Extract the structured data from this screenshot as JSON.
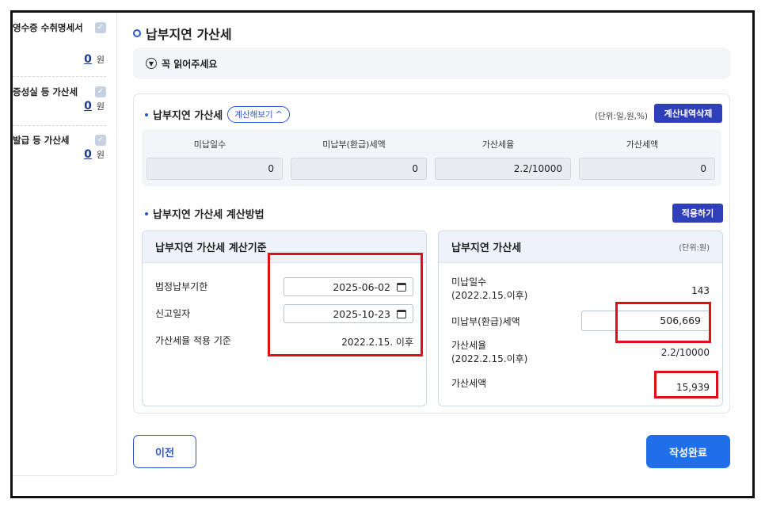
{
  "sidebar": {
    "items": [
      {
        "title": "영수증 수취명세서",
        "amount": "0",
        "unit": "원"
      },
      {
        "title": "증성실 등 가산세",
        "amount": "0",
        "unit": "원"
      },
      {
        "title": "발급 등 가산세",
        "amount": "0",
        "unit": "원"
      }
    ],
    "check_glyph": "✓"
  },
  "page": {
    "title": "납부지연 가산세",
    "read_notice": "꼭 읽어주세요"
  },
  "summary": {
    "title": "납부지연 가산세",
    "calc_toggle": "계산해보기 ^",
    "unit": "(단위:일,원,%)",
    "delete_button": "계산내역삭제",
    "columns": [
      "미납일수",
      "미납부(환급)세액",
      "가산세율",
      "가산세액"
    ],
    "values": [
      "0",
      "0",
      "2.2/10000",
      "0"
    ]
  },
  "method": {
    "title": "납부지연 가산세 계산방법",
    "apply_button": "적용하기"
  },
  "criteria": {
    "title": "납부지연 가산세 계산기준",
    "due_date_label": "법정납부기한",
    "due_date_value": "2025-06-02",
    "report_date_label": "신고일자",
    "report_date_value": "2025-10-23",
    "rate_basis_label": "가산세율 적용 기준",
    "rate_basis_value": "2022.2.15. 이후"
  },
  "result": {
    "title": "납부지연 가산세",
    "unit": "(단위:원)",
    "days_label_1": "미납일수",
    "days_label_2": "(2022.2.15.이후)",
    "days_value": "143",
    "unpaid_label": "미납부(환급)세액",
    "unpaid_value": "506,669",
    "rate_label_1": "가산세율",
    "rate_label_2": "(2022.2.15.이후)",
    "rate_value": "2.2/10000",
    "penalty_label": "가산세액",
    "penalty_value": "15,939"
  },
  "footer": {
    "prev_button": "이전",
    "complete_button": "작성완료"
  },
  "colors": {
    "accent": "#2e56c9",
    "primary_button": "#1f6fea",
    "navy_button": "#2f3fb8",
    "highlight": "#e0101a"
  }
}
